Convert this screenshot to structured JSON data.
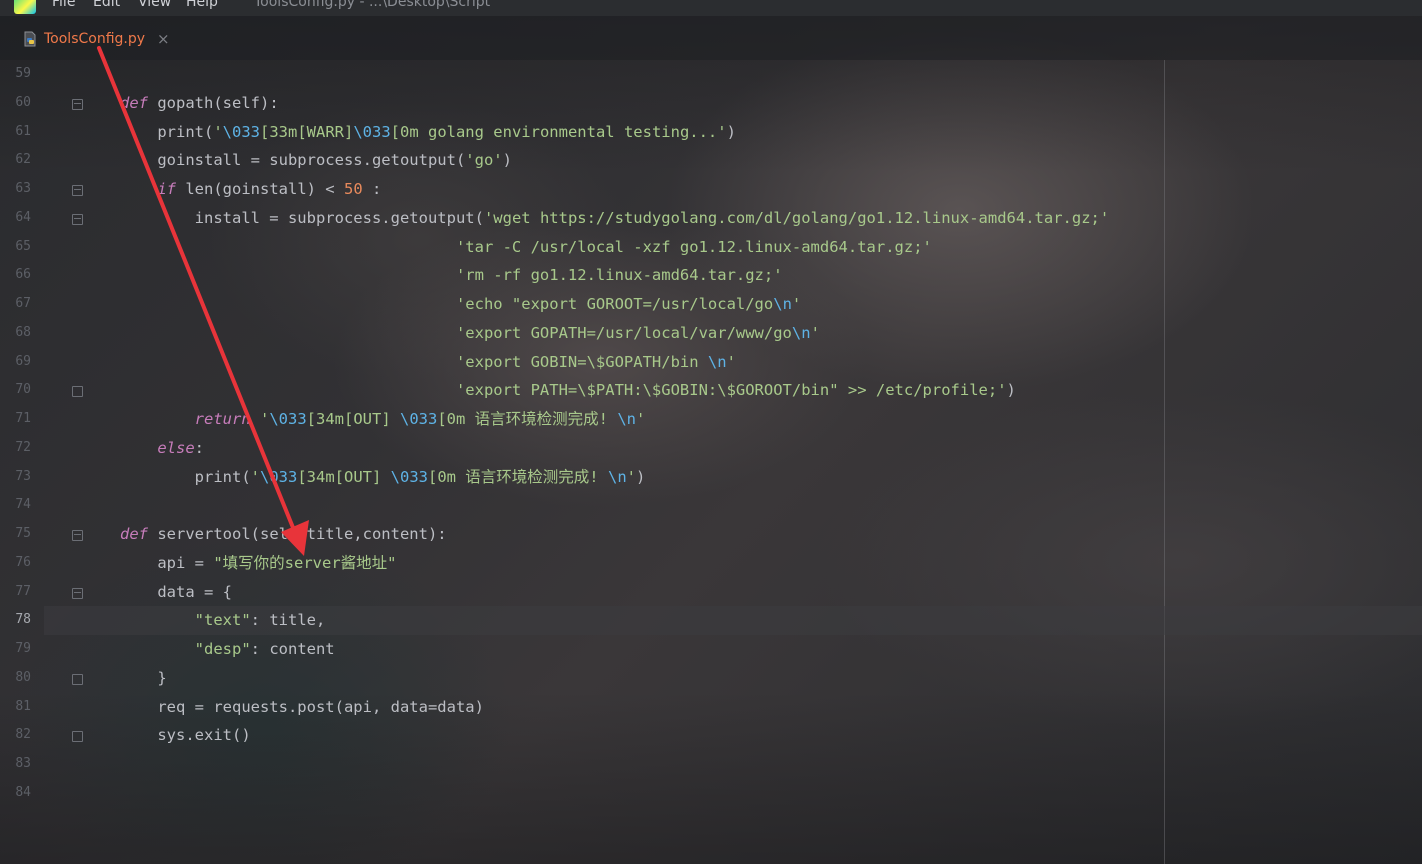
{
  "menu": {
    "items": [
      "File",
      "Edit",
      "View",
      "Help"
    ],
    "path": "ToolsConfig.py - ...\\Desktop\\Script"
  },
  "tab": {
    "label": "ToolsConfig.py",
    "close": "×"
  },
  "editor": {
    "current_line": 78,
    "lines": [
      {
        "no": "59",
        "fold": "",
        "tokens": []
      },
      {
        "no": "60",
        "fold": "open",
        "tokens": [
          [
            "kw",
            "def"
          ],
          [
            "op",
            " gopath(self):"
          ]
        ]
      },
      {
        "no": "61",
        "fold": "",
        "tokens": [
          [
            "op",
            "    print("
          ],
          [
            "str",
            "'"
          ],
          [
            "esc",
            "\\033"
          ],
          [
            "str",
            "[33m[WARR]"
          ],
          [
            "esc",
            "\\033"
          ],
          [
            "str",
            "[0m golang environmental testing...'"
          ],
          [
            "op",
            ")"
          ]
        ]
      },
      {
        "no": "62",
        "fold": "",
        "tokens": [
          [
            "op",
            "    goinstall = subprocess.getoutput("
          ],
          [
            "str",
            "'go'"
          ],
          [
            "op",
            ")"
          ]
        ]
      },
      {
        "no": "63",
        "fold": "open",
        "tokens": [
          [
            "kw",
            "    if"
          ],
          [
            "op",
            " len(goinstall) < "
          ],
          [
            "num",
            "50"
          ],
          [
            "op",
            " :"
          ]
        ]
      },
      {
        "no": "64",
        "fold": "open",
        "tokens": [
          [
            "op",
            "        install = subprocess.getoutput("
          ],
          [
            "str",
            "'wget https://studygolang.com/dl/golang/go1.12.linux-amd64.tar.gz;'"
          ]
        ]
      },
      {
        "no": "65",
        "fold": "",
        "tokens": [
          [
            "str",
            "                                    'tar -C /usr/local -xzf go1.12.linux-amd64.tar.gz;'"
          ]
        ]
      },
      {
        "no": "66",
        "fold": "",
        "tokens": [
          [
            "str",
            "                                    'rm -rf go1.12.linux-amd64.tar.gz;'"
          ]
        ]
      },
      {
        "no": "67",
        "fold": "",
        "tokens": [
          [
            "str",
            "                                    'echo \"export GOROOT=/usr/local/go"
          ],
          [
            "esc",
            "\\n"
          ],
          [
            "str",
            "'"
          ]
        ]
      },
      {
        "no": "68",
        "fold": "",
        "tokens": [
          [
            "str",
            "                                    'export GOPATH=/usr/local/var/www/go"
          ],
          [
            "esc",
            "\\n"
          ],
          [
            "str",
            "'"
          ]
        ]
      },
      {
        "no": "69",
        "fold": "",
        "tokens": [
          [
            "str",
            "                                    'export GOBIN=\\$GOPATH/bin "
          ],
          [
            "esc",
            "\\n"
          ],
          [
            "str",
            "'"
          ]
        ]
      },
      {
        "no": "70",
        "fold": "close",
        "tokens": [
          [
            "str",
            "                                    'export PATH=\\$PATH:\\$GOBIN:\\$GOROOT/bin\" >> /etc/profile;'"
          ],
          [
            "op",
            ")"
          ]
        ]
      },
      {
        "no": "71",
        "fold": "",
        "tokens": [
          [
            "kw",
            "        return"
          ],
          [
            "op",
            " "
          ],
          [
            "str",
            "'"
          ],
          [
            "esc",
            "\\033"
          ],
          [
            "str",
            "[34m[OUT] "
          ],
          [
            "esc",
            "\\033"
          ],
          [
            "str",
            "[0m 语言环境检测完成! "
          ],
          [
            "esc",
            "\\n"
          ],
          [
            "str",
            "'"
          ]
        ]
      },
      {
        "no": "72",
        "fold": "",
        "tokens": [
          [
            "kw",
            "    else"
          ],
          [
            "op",
            ":"
          ]
        ]
      },
      {
        "no": "73",
        "fold": "",
        "tokens": [
          [
            "op",
            "        print("
          ],
          [
            "str",
            "'"
          ],
          [
            "esc",
            "\\033"
          ],
          [
            "str",
            "[34m[OUT] "
          ],
          [
            "esc",
            "\\033"
          ],
          [
            "str",
            "[0m 语言环境检测完成! "
          ],
          [
            "esc",
            "\\n"
          ],
          [
            "str",
            "'"
          ],
          [
            "op",
            ")"
          ]
        ]
      },
      {
        "no": "74",
        "fold": "",
        "tokens": []
      },
      {
        "no": "75",
        "fold": "open",
        "tokens": [
          [
            "kw",
            "def"
          ],
          [
            "op",
            " servertool(self,title,content):"
          ]
        ]
      },
      {
        "no": "76",
        "fold": "",
        "tokens": [
          [
            "op",
            "    api = "
          ],
          [
            "str",
            "\"填写你的server酱地址\""
          ]
        ]
      },
      {
        "no": "77",
        "fold": "open",
        "tokens": [
          [
            "op",
            "    data = {"
          ]
        ]
      },
      {
        "no": "78",
        "fold": "",
        "tokens": [
          [
            "str",
            "        \"text\""
          ],
          [
            "op",
            ": title,"
          ]
        ]
      },
      {
        "no": "79",
        "fold": "",
        "tokens": [
          [
            "str",
            "        \"desp\""
          ],
          [
            "op",
            ": content"
          ]
        ]
      },
      {
        "no": "80",
        "fold": "close",
        "tokens": [
          [
            "op",
            "    }"
          ]
        ]
      },
      {
        "no": "81",
        "fold": "",
        "tokens": [
          [
            "op",
            "    req = requests.post(api, data=data)"
          ]
        ]
      },
      {
        "no": "82",
        "fold": "close",
        "tokens": [
          [
            "op",
            "    sys.exit()"
          ]
        ]
      },
      {
        "no": "83",
        "fold": "",
        "tokens": []
      },
      {
        "no": "84",
        "fold": "",
        "tokens": []
      }
    ]
  },
  "annotation_color": "#e8343a"
}
